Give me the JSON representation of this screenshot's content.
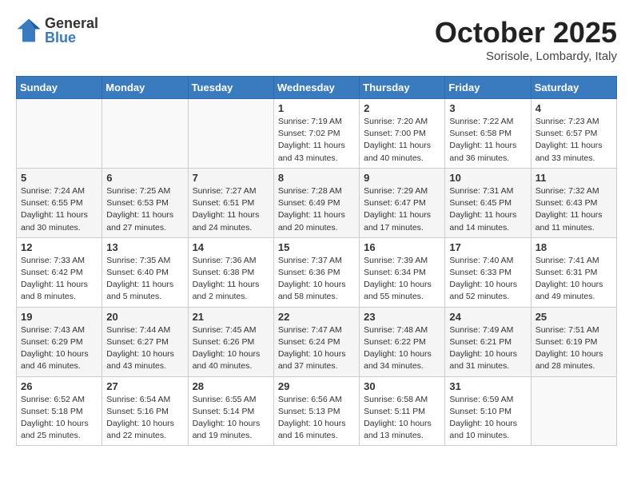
{
  "logo": {
    "general": "General",
    "blue": "Blue"
  },
  "title": "October 2025",
  "location": "Sorisole, Lombardy, Italy",
  "headers": [
    "Sunday",
    "Monday",
    "Tuesday",
    "Wednesday",
    "Thursday",
    "Friday",
    "Saturday"
  ],
  "weeks": [
    [
      {
        "num": "",
        "info": ""
      },
      {
        "num": "",
        "info": ""
      },
      {
        "num": "",
        "info": ""
      },
      {
        "num": "1",
        "info": "Sunrise: 7:19 AM\nSunset: 7:02 PM\nDaylight: 11 hours\nand 43 minutes."
      },
      {
        "num": "2",
        "info": "Sunrise: 7:20 AM\nSunset: 7:00 PM\nDaylight: 11 hours\nand 40 minutes."
      },
      {
        "num": "3",
        "info": "Sunrise: 7:22 AM\nSunset: 6:58 PM\nDaylight: 11 hours\nand 36 minutes."
      },
      {
        "num": "4",
        "info": "Sunrise: 7:23 AM\nSunset: 6:57 PM\nDaylight: 11 hours\nand 33 minutes."
      }
    ],
    [
      {
        "num": "5",
        "info": "Sunrise: 7:24 AM\nSunset: 6:55 PM\nDaylight: 11 hours\nand 30 minutes."
      },
      {
        "num": "6",
        "info": "Sunrise: 7:25 AM\nSunset: 6:53 PM\nDaylight: 11 hours\nand 27 minutes."
      },
      {
        "num": "7",
        "info": "Sunrise: 7:27 AM\nSunset: 6:51 PM\nDaylight: 11 hours\nand 24 minutes."
      },
      {
        "num": "8",
        "info": "Sunrise: 7:28 AM\nSunset: 6:49 PM\nDaylight: 11 hours\nand 20 minutes."
      },
      {
        "num": "9",
        "info": "Sunrise: 7:29 AM\nSunset: 6:47 PM\nDaylight: 11 hours\nand 17 minutes."
      },
      {
        "num": "10",
        "info": "Sunrise: 7:31 AM\nSunset: 6:45 PM\nDaylight: 11 hours\nand 14 minutes."
      },
      {
        "num": "11",
        "info": "Sunrise: 7:32 AM\nSunset: 6:43 PM\nDaylight: 11 hours\nand 11 minutes."
      }
    ],
    [
      {
        "num": "12",
        "info": "Sunrise: 7:33 AM\nSunset: 6:42 PM\nDaylight: 11 hours\nand 8 minutes."
      },
      {
        "num": "13",
        "info": "Sunrise: 7:35 AM\nSunset: 6:40 PM\nDaylight: 11 hours\nand 5 minutes."
      },
      {
        "num": "14",
        "info": "Sunrise: 7:36 AM\nSunset: 6:38 PM\nDaylight: 11 hours\nand 2 minutes."
      },
      {
        "num": "15",
        "info": "Sunrise: 7:37 AM\nSunset: 6:36 PM\nDaylight: 10 hours\nand 58 minutes."
      },
      {
        "num": "16",
        "info": "Sunrise: 7:39 AM\nSunset: 6:34 PM\nDaylight: 10 hours\nand 55 minutes."
      },
      {
        "num": "17",
        "info": "Sunrise: 7:40 AM\nSunset: 6:33 PM\nDaylight: 10 hours\nand 52 minutes."
      },
      {
        "num": "18",
        "info": "Sunrise: 7:41 AM\nSunset: 6:31 PM\nDaylight: 10 hours\nand 49 minutes."
      }
    ],
    [
      {
        "num": "19",
        "info": "Sunrise: 7:43 AM\nSunset: 6:29 PM\nDaylight: 10 hours\nand 46 minutes."
      },
      {
        "num": "20",
        "info": "Sunrise: 7:44 AM\nSunset: 6:27 PM\nDaylight: 10 hours\nand 43 minutes."
      },
      {
        "num": "21",
        "info": "Sunrise: 7:45 AM\nSunset: 6:26 PM\nDaylight: 10 hours\nand 40 minutes."
      },
      {
        "num": "22",
        "info": "Sunrise: 7:47 AM\nSunset: 6:24 PM\nDaylight: 10 hours\nand 37 minutes."
      },
      {
        "num": "23",
        "info": "Sunrise: 7:48 AM\nSunset: 6:22 PM\nDaylight: 10 hours\nand 34 minutes."
      },
      {
        "num": "24",
        "info": "Sunrise: 7:49 AM\nSunset: 6:21 PM\nDaylight: 10 hours\nand 31 minutes."
      },
      {
        "num": "25",
        "info": "Sunrise: 7:51 AM\nSunset: 6:19 PM\nDaylight: 10 hours\nand 28 minutes."
      }
    ],
    [
      {
        "num": "26",
        "info": "Sunrise: 6:52 AM\nSunset: 5:18 PM\nDaylight: 10 hours\nand 25 minutes."
      },
      {
        "num": "27",
        "info": "Sunrise: 6:54 AM\nSunset: 5:16 PM\nDaylight: 10 hours\nand 22 minutes."
      },
      {
        "num": "28",
        "info": "Sunrise: 6:55 AM\nSunset: 5:14 PM\nDaylight: 10 hours\nand 19 minutes."
      },
      {
        "num": "29",
        "info": "Sunrise: 6:56 AM\nSunset: 5:13 PM\nDaylight: 10 hours\nand 16 minutes."
      },
      {
        "num": "30",
        "info": "Sunrise: 6:58 AM\nSunset: 5:11 PM\nDaylight: 10 hours\nand 13 minutes."
      },
      {
        "num": "31",
        "info": "Sunrise: 6:59 AM\nSunset: 5:10 PM\nDaylight: 10 hours\nand 10 minutes."
      },
      {
        "num": "",
        "info": ""
      }
    ]
  ]
}
